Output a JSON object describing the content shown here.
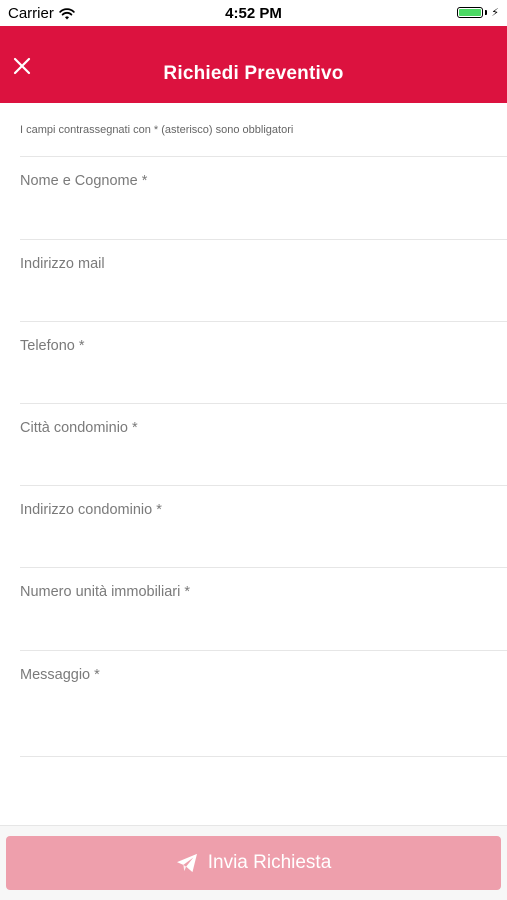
{
  "status_bar": {
    "carrier": "Carrier",
    "time": "4:52 PM"
  },
  "header": {
    "title": "Richiedi Preventivo",
    "background_color": "#dc123f"
  },
  "form": {
    "hint": "I campi contrassegnati con * (asterisco) sono obbligatori",
    "fields": [
      {
        "label": "Nome e Cognome *",
        "value": ""
      },
      {
        "label": "Indirizzo mail",
        "value": ""
      },
      {
        "label": "Telefono *",
        "value": ""
      },
      {
        "label": "Città condominio *",
        "value": ""
      },
      {
        "label": "Indirizzo condominio *",
        "value": ""
      },
      {
        "label": "Numero unità immobiliari *",
        "value": ""
      },
      {
        "label": "Messaggio *",
        "value": ""
      }
    ]
  },
  "footer": {
    "submit_label": "Invia Richiesta",
    "submit_icon": "paper-plane-icon",
    "submit_color": "#ee9fac"
  }
}
